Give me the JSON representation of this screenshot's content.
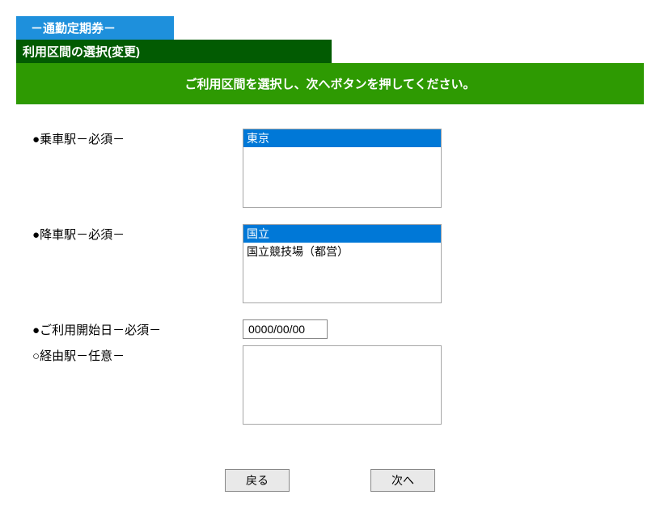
{
  "tabs": {
    "main_tab_label": "－通勤定期券－"
  },
  "subtab": {
    "title": "利用区間の選択(変更)"
  },
  "instruction": "ご利用区間を選択し、次へボタンを押してください。",
  "fields": {
    "boarding": {
      "bullet": "●",
      "label": "乗車駅－必須－",
      "options": [
        {
          "text": "東京",
          "selected": true
        }
      ]
    },
    "alighting": {
      "bullet": "●",
      "label": "降車駅－必須－",
      "options": [
        {
          "text": "国立",
          "selected": true
        },
        {
          "text": "国立競技場（都営）",
          "selected": false
        }
      ]
    },
    "start_date": {
      "bullet": "●",
      "label": "ご利用開始日－必須－",
      "value": "0000/00/00"
    },
    "via": {
      "bullet": "○",
      "label": "経由駅－任意－",
      "options": []
    }
  },
  "buttons": {
    "back": "戻る",
    "next": "次へ"
  }
}
